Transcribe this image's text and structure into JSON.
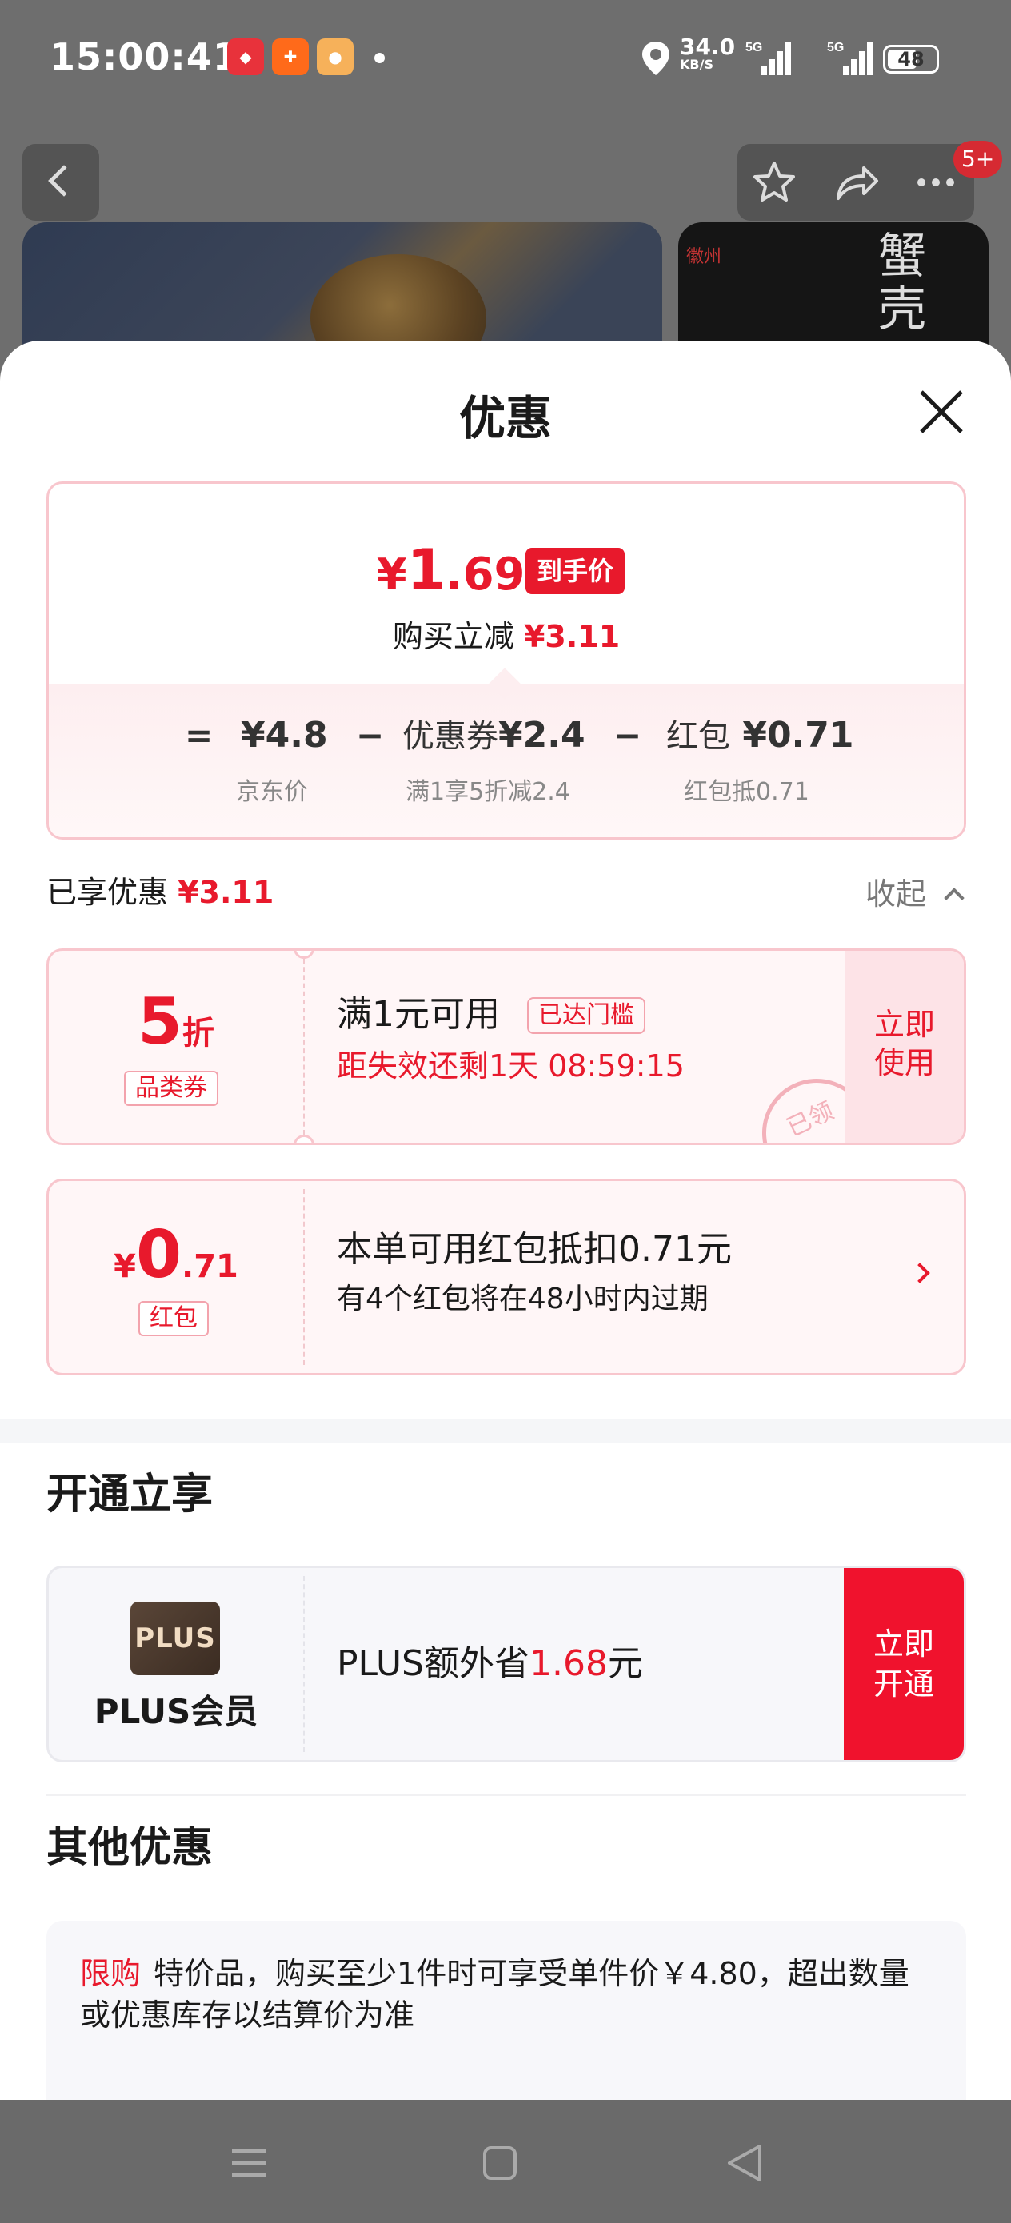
{
  "status_bar": {
    "time": "15:00:41",
    "net_speed": "34.0",
    "net_unit": "KB/S",
    "battery": "48",
    "sig1_label": "5G",
    "sig2_label": "5G"
  },
  "header": {
    "badge": "5+"
  },
  "sheet": {
    "title": "优惠"
  },
  "price_summary": {
    "currency": "¥",
    "price_int": "1",
    "price_dec": ".69",
    "tag": "到手价",
    "save_label": "购买立减",
    "save_amount": "¥3.11",
    "equals": "=",
    "minus": "−",
    "jd_price": "¥4.8",
    "jd_price_label": "京东价",
    "coupon_label": "优惠券",
    "coupon_value": "¥2.4",
    "coupon_desc": "满1享5折减2.4",
    "packet_label": "红包",
    "packet_value": "¥0.71",
    "packet_desc": "红包抵0.71"
  },
  "enjoyed": {
    "label": "已享优惠",
    "amount": "¥3.11",
    "collapse": "收起"
  },
  "coupon": {
    "discount": "5",
    "discount_unit": "折",
    "type_tag": "品类券",
    "title": "满1元可用",
    "threshold_tag": "已达门槛",
    "expire_text": "距失效还剩1天 08:59:15",
    "action": "立即使用",
    "stamp": "已领"
  },
  "red_packet": {
    "currency": "¥",
    "amount_int": "0",
    "amount_dec": ".71",
    "type_tag": "红包",
    "title": "本单可用红包抵扣0.71元",
    "subtitle": "有4个红包将在48小时内过期"
  },
  "plus_section": {
    "title": "开通立享",
    "logo_text": "PLUS",
    "name": "PLUS会员",
    "text_prefix": "PLUS额外省",
    "amount": "1.68",
    "text_suffix": "元",
    "action": "立即开通"
  },
  "other_section": {
    "title": "其他优惠",
    "tag": "限购",
    "text": "特价品，购买至少1件时可享受单件价￥4.80，超出数量或优惠库存以结算价为准"
  },
  "colors": {
    "accent": "#e8192c",
    "plus_button": "#f0122d"
  }
}
